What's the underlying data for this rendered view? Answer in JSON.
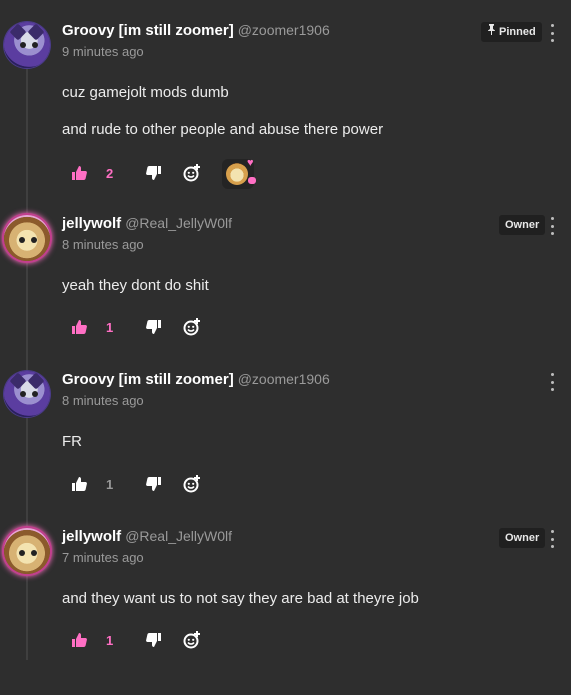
{
  "comments": [
    {
      "author": "Groovy [im still zoomer]",
      "handle": "@zoomer1906",
      "time": "9 minutes ago",
      "badge": "Pinned",
      "lines": [
        "cuz gamejolt mods dumb",
        "and rude to other people and abuse there power"
      ],
      "likes": "2",
      "liked": true,
      "has_reaction": true
    },
    {
      "author": "jellywolf",
      "handle": "@Real_JellyW0lf",
      "time": "8 minutes ago",
      "badge": "Owner",
      "lines": [
        "yeah they dont do shit"
      ],
      "likes": "1",
      "liked": true
    },
    {
      "author": "Groovy [im still zoomer]",
      "handle": "@zoomer1906",
      "time": "8 minutes ago",
      "lines": [
        "FR"
      ],
      "likes": "1",
      "liked": false
    },
    {
      "author": "jellywolf",
      "handle": "@Real_JellyW0lf",
      "time": "7 minutes ago",
      "badge": "Owner",
      "lines": [
        "and they want us to not say they are bad at theyre job"
      ],
      "likes": "1",
      "liked": true
    }
  ],
  "icons": {
    "like": "thumbs-up-icon",
    "dislike": "thumbs-down-icon",
    "react": "add-reaction-icon",
    "more": "more-options-icon",
    "pin": "pin-icon"
  },
  "colors": {
    "background": "#2e2e2e",
    "accent_pink": "#ff6fc4",
    "muted": "#9a9a9a"
  }
}
